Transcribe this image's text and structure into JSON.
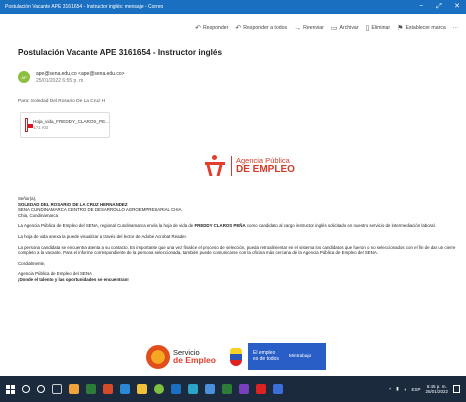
{
  "window": {
    "title": "Postulación Vacante APE 3161654 - Instructor inglés: mensaje - Correo",
    "minimize": "−",
    "maximize": "⤢",
    "close": "✕"
  },
  "toolbar": {
    "reply": "Responder",
    "reply_all": "Responder a todos",
    "forward": "Reenviar",
    "archive": "Archivar",
    "delete": "Eliminar",
    "set_flag": "Establecer marca",
    "more": "···"
  },
  "message": {
    "subject": "Postulación Vacante APE 3161654 - Instructor inglés",
    "avatar_initials": "AP",
    "sender": "ape@sena.edu.co <ape@sena.edu.co>",
    "date": "25/01/2022 6:55 p. m.",
    "to": "Para: Soledad Del Rosario De La Cruz H",
    "attachment": {
      "name": "Hoja_vida_FREDDY_CLAROS_PE...",
      "size": "171 KB"
    }
  },
  "logo": {
    "line1": "Agencia Pública",
    "line2": "DE EMPLEO",
    "sena": "SENA"
  },
  "body": {
    "greeting": "Señor(a),",
    "recipient_name": "SOLEDAD DEL ROSARIO DE LA CRUZ HERNANDEZ",
    "recipient_org": "SENA CUNDINAMARCA CENTRO DE DESARROLLO AGROEMPRESARIAL CHIA",
    "recipient_city": "Chia, Cundinamarca",
    "p1_a": "La Agencia Pública de Empleo del SENA, regional Cundinamarca envía la hoja de vida de ",
    "p1_name": "FREDDY CLAROS PEÑA",
    "p1_b": " como candidato al cargo instructor inglés solicitado en nuestro servicio de intermediación laboral.",
    "p2": "La hoja de vida anexa la puede visualizar a través del lector de Adobe Acrobat Reader.",
    "p3": "La persona candidata se encuentra atenta a su contacto. Es importante que una vez finalice el proceso de selección, pueda retroalimentar en el sistema los candidatos que fueron o no seleccionados con el fin de dar un cierre completo a la vacante. Para el informe correspondiente de la persona seleccionada, también puede comunicarse con la oficina más cercana de la Agencia Pública de Empleo del SENA.",
    "closing": "Cordialmente,",
    "signature1": "Agencia Pública de Empleo del SENA",
    "signature2": "¡Donde el talento y las oportunidades se encuentran!"
  },
  "footer": {
    "servicio_line1": "Servicio",
    "servicio_line2": "de Empleo",
    "empleo_line1": "El empleo",
    "empleo_line2": "es de todos",
    "ministry": "Mintrabajo"
  },
  "taskbar": {
    "time": "6:45 p. m.",
    "date": "25/01/2022",
    "lang": "ESP"
  },
  "colors": {
    "titlebar": "#1a6fc0",
    "brand_red": "#d23b2a",
    "taskbar": "#1b2a3d",
    "banner_blue": "#2a5ec7"
  }
}
